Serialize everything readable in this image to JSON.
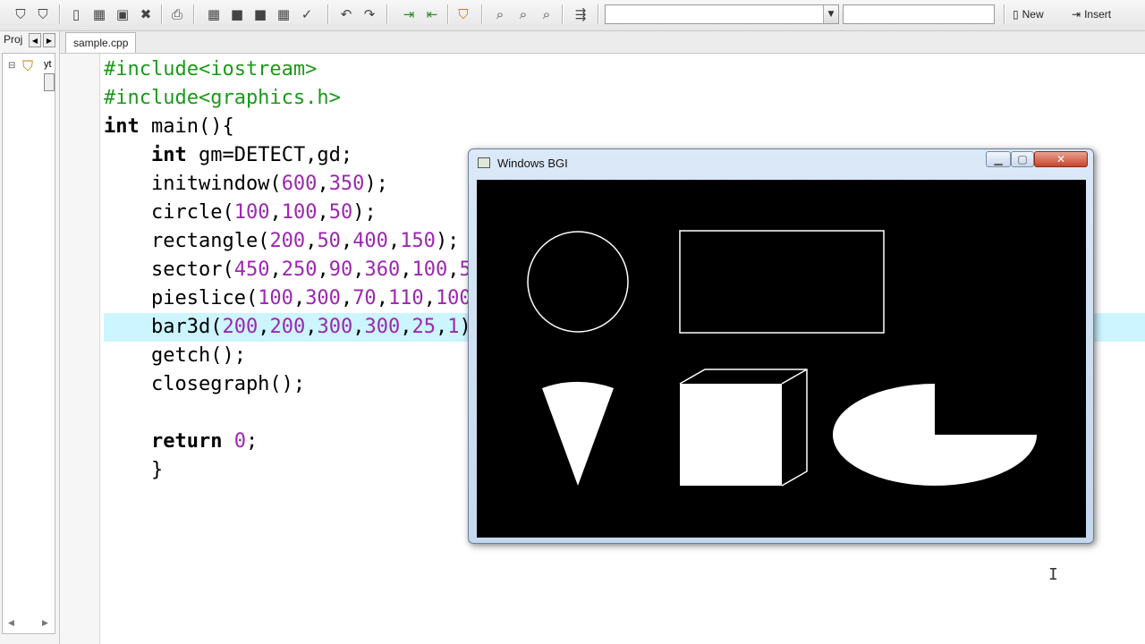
{
  "toolbar": {
    "new_label": "New",
    "insert_label": "Insert",
    "combo1_value": "",
    "combo2_value": ""
  },
  "left_panel": {
    "tab_label": "Proj",
    "tree_item": "yt"
  },
  "editor": {
    "tab_label": "sample.cpp",
    "active_line": 10,
    "lines": [
      "#include<iostream>",
      "#include<graphics.h>",
      "int main(){",
      "    int gm=DETECT,gd;",
      "    initwindow(600,350);",
      "    circle(100,100,50);",
      "    rectangle(200,50,400,150);",
      "    sector(450,250,90,360,100,50);",
      "    pieslice(100,300,70,110,100);",
      "    bar3d(200,200,300,300,25,1);",
      "    getch();",
      "    closegraph();",
      "",
      "    return 0;",
      "    }"
    ]
  },
  "bgi_window": {
    "title": "Windows BGI",
    "minimize_icon": "minimize-icon",
    "maximize_icon": "maximize-icon",
    "close_icon": "close-icon"
  },
  "colors": {
    "preprocessor": "#1a9a1a",
    "number": "#9c27b0",
    "active_line_bg": "#ccf5ff",
    "canvas_bg": "#000000",
    "shape_color": "#ffffff"
  }
}
